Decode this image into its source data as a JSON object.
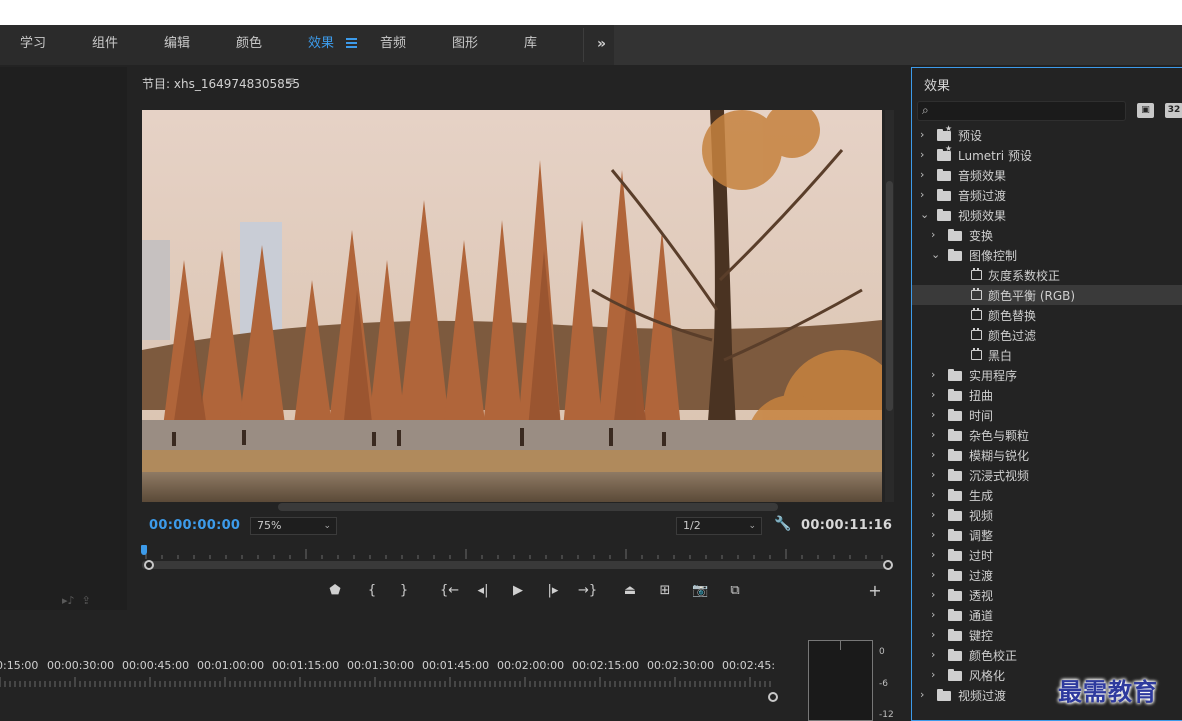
{
  "workspaces": {
    "tabs": [
      "学习",
      "组件",
      "编辑",
      "颜色",
      "效果",
      "音频",
      "图形",
      "库"
    ],
    "active_index": 4,
    "more_icon": "double-chevron-right-icon"
  },
  "program_monitor": {
    "title": "节目: xhs_1649748305855",
    "current_time": "00:00:00:00",
    "zoom": "75%",
    "resolution": "1/2",
    "duration": "00:00:11:16"
  },
  "timeline": {
    "ruler_labels": [
      "0:15:00",
      "00:00:30:00",
      "00:00:45:00",
      "00:01:00:00",
      "00:01:15:00",
      "00:01:30:00",
      "00:01:45:00",
      "00:02:00:00",
      "00:02:15:00",
      "00:02:30:00",
      "00:02:45:"
    ]
  },
  "audio_meter": {
    "labels": [
      "0",
      "-6",
      "-12"
    ]
  },
  "effects_panel": {
    "title": "效果",
    "search_placeholder": "",
    "btn_accel": "▣",
    "btn_32": "32",
    "items": [
      {
        "label": "预设",
        "level": 0,
        "type": "folder-star",
        "expanded": false
      },
      {
        "label": "Lumetri 预设",
        "level": 0,
        "type": "folder-star",
        "expanded": false
      },
      {
        "label": "音频效果",
        "level": 0,
        "type": "folder",
        "expanded": false
      },
      {
        "label": "音频过渡",
        "level": 0,
        "type": "folder",
        "expanded": false
      },
      {
        "label": "视频效果",
        "level": 0,
        "type": "folder",
        "expanded": true
      },
      {
        "label": "变换",
        "level": 1,
        "type": "folder",
        "expanded": false
      },
      {
        "label": "图像控制",
        "level": 1,
        "type": "folder",
        "expanded": true
      },
      {
        "label": "灰度系数校正",
        "level": 2,
        "type": "effect"
      },
      {
        "label": "颜色平衡 (RGB)",
        "level": 2,
        "type": "effect",
        "selected": true
      },
      {
        "label": "颜色替换",
        "level": 2,
        "type": "effect"
      },
      {
        "label": "颜色过滤",
        "level": 2,
        "type": "effect"
      },
      {
        "label": "黑白",
        "level": 2,
        "type": "effect"
      },
      {
        "label": "实用程序",
        "level": 1,
        "type": "folder",
        "expanded": false
      },
      {
        "label": "扭曲",
        "level": 1,
        "type": "folder",
        "expanded": false
      },
      {
        "label": "时间",
        "level": 1,
        "type": "folder",
        "expanded": false
      },
      {
        "label": "杂色与颗粒",
        "level": 1,
        "type": "folder",
        "expanded": false
      },
      {
        "label": "模糊与锐化",
        "level": 1,
        "type": "folder",
        "expanded": false
      },
      {
        "label": "沉浸式视频",
        "level": 1,
        "type": "folder",
        "expanded": false
      },
      {
        "label": "生成",
        "level": 1,
        "type": "folder",
        "expanded": false
      },
      {
        "label": "视频",
        "level": 1,
        "type": "folder",
        "expanded": false
      },
      {
        "label": "调整",
        "level": 1,
        "type": "folder",
        "expanded": false
      },
      {
        "label": "过时",
        "level": 1,
        "type": "folder",
        "expanded": false
      },
      {
        "label": "过渡",
        "level": 1,
        "type": "folder",
        "expanded": false
      },
      {
        "label": "透视",
        "level": 1,
        "type": "folder",
        "expanded": false
      },
      {
        "label": "通道",
        "level": 1,
        "type": "folder",
        "expanded": false
      },
      {
        "label": "键控",
        "level": 1,
        "type": "folder",
        "expanded": false
      },
      {
        "label": "颜色校正",
        "level": 1,
        "type": "folder",
        "expanded": false
      },
      {
        "label": "风格化",
        "level": 1,
        "type": "folder",
        "expanded": false
      },
      {
        "label": "视频过渡",
        "level": 0,
        "type": "folder",
        "expanded": false
      }
    ]
  },
  "watermark": "最需教育",
  "colors": {
    "accent": "#3d9bea",
    "panel_bg": "#232323",
    "selected_row": "#3a3a3a"
  }
}
